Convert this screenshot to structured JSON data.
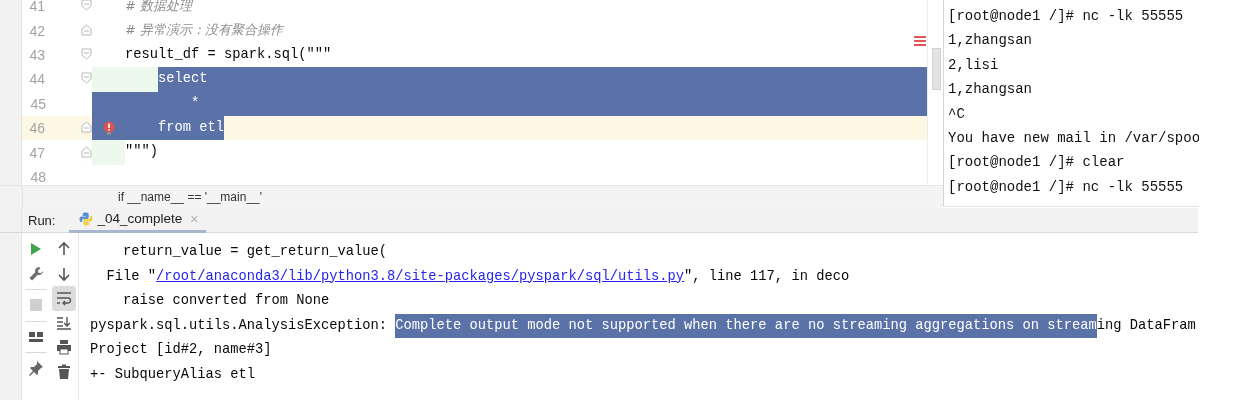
{
  "editor": {
    "lines": [
      {
        "number": "41",
        "text": "# 数据处理",
        "kind": "comment",
        "fold_start": true,
        "fold_end": false,
        "selected": false,
        "changed": false,
        "current": false,
        "error": false
      },
      {
        "number": "42",
        "text": "# 异常演示：没有聚合操作",
        "kind": "comment",
        "fold_start": false,
        "fold_end": true,
        "selected": false,
        "changed": false,
        "current": false,
        "error": false
      },
      {
        "number": "43",
        "text": "result_df = spark.sql(\"\"\"",
        "kind": "code",
        "fold_start": true,
        "fold_end": false,
        "selected": false,
        "changed": false,
        "current": false,
        "error": false
      },
      {
        "number": "44",
        "text": "    select",
        "kind": "code",
        "fold_start": true,
        "fold_end": false,
        "selected": true,
        "changed": true,
        "current": false,
        "error": false
      },
      {
        "number": "45",
        "text": "        *",
        "kind": "code",
        "fold_start": false,
        "fold_end": false,
        "selected": true,
        "changed": false,
        "current": false,
        "error": false
      },
      {
        "number": "46",
        "text": "    from etl",
        "kind": "code",
        "fold_start": false,
        "fold_end": true,
        "selected": true,
        "changed": false,
        "current": true,
        "error": true
      },
      {
        "number": "47",
        "text": "\"\"\")",
        "kind": "code",
        "fold_start": false,
        "fold_end": true,
        "selected": false,
        "changed": true,
        "current": false,
        "error": false
      },
      {
        "number": "48",
        "fold_start": false,
        "fold_end": false,
        "selected": false,
        "changed": false,
        "current": false,
        "error": false
      }
    ],
    "breadcrumb": "if __name__ == '__main__'"
  },
  "terminal": {
    "lines": [
      "[root@node1 /]# nc -lk 55555",
      "1,zhangsan",
      "2,lisi",
      "1,zhangsan",
      "^C",
      "You have new mail in /var/spoo",
      "[root@node1 /]# clear",
      "[root@node1 /]# nc -lk 55555"
    ]
  },
  "run_panel": {
    "label": "Run:",
    "tab": {
      "title": "_04_complete",
      "close": "×",
      "selected": true
    },
    "left_toolbar": [
      {
        "kind": "run",
        "disabled": false
      },
      {
        "kind": "wrench",
        "disabled": false
      },
      {
        "kind": "separator"
      },
      {
        "kind": "stop",
        "disabled": true
      },
      {
        "kind": "separator"
      },
      {
        "kind": "layout",
        "disabled": false
      },
      {
        "kind": "separator"
      },
      {
        "kind": "pin",
        "disabled": false
      }
    ],
    "right_toolbar": [
      {
        "kind": "up",
        "on": false
      },
      {
        "kind": "down",
        "on": false
      },
      {
        "kind": "wrap",
        "on": true
      },
      {
        "kind": "scroll-end",
        "on": false
      },
      {
        "kind": "print",
        "on": false
      },
      {
        "kind": "trash",
        "on": false
      }
    ],
    "console": [
      [
        {
          "kind": "text",
          "text": "    return_value = get_return_value("
        }
      ],
      [
        {
          "kind": "text",
          "text": "  File \""
        },
        {
          "kind": "link",
          "text": "/root/anaconda3/lib/python3.8/site-packages/pyspark/sql/utils.py"
        },
        {
          "kind": "text",
          "text": "\", line 117, in deco"
        }
      ],
      [
        {
          "kind": "text",
          "text": "    raise converted from None"
        }
      ],
      [
        {
          "kind": "text",
          "text": "pyspark.sql.utils.AnalysisException: "
        },
        {
          "kind": "selected",
          "text": "Complete output mode not supported when there are no streaming aggregations on stream"
        },
        {
          "kind": "text",
          "text": "ing DataFram"
        }
      ],
      [
        {
          "kind": "text",
          "text": "Project [id#2, name#3]"
        }
      ],
      [
        {
          "kind": "text",
          "text": "+- SubqueryAlias etl"
        }
      ]
    ]
  }
}
